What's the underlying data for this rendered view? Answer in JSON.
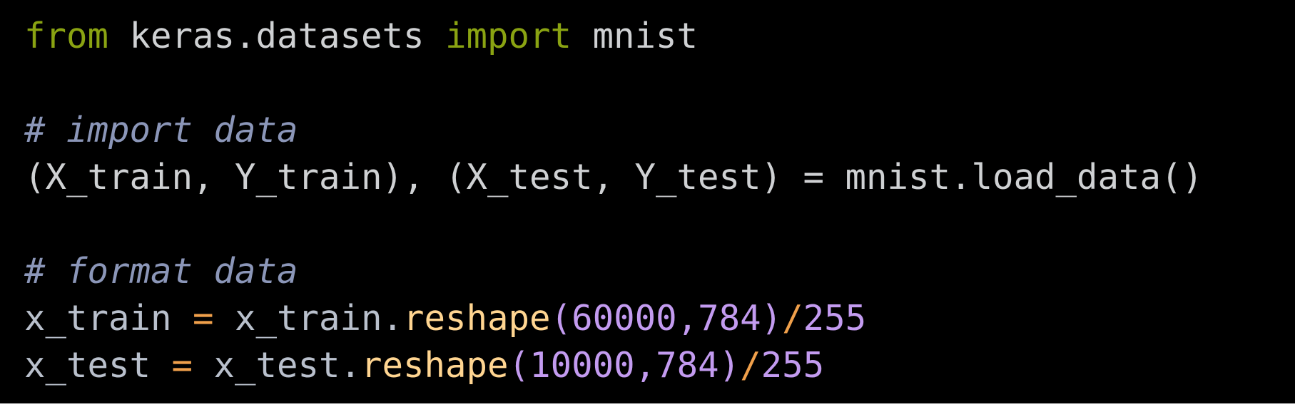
{
  "code": {
    "line1": {
      "kw_from": "from",
      "module": " keras.datasets ",
      "kw_import": "import",
      "name": " mnist"
    },
    "line3": {
      "comment": "# import data"
    },
    "line4": {
      "text": "(X_train, Y_train), (X_test, Y_test) = mnist.load_data()"
    },
    "line6": {
      "comment": "# format data"
    },
    "line7": {
      "var": "x_train ",
      "eq": "=",
      "obj": " x_train.",
      "method": "reshape",
      "args": "(60000,784)",
      "div": "/",
      "divisor": "255"
    },
    "line8": {
      "var": "x_test ",
      "eq": "=",
      "obj": " x_test.",
      "method": "reshape",
      "args": "(10000,784)",
      "div": "/",
      "divisor": "255"
    }
  },
  "colors": {
    "background": "#000000",
    "keyword": "#8aa312",
    "comment": "#8b96b8",
    "operator": "#f0a04b",
    "function": "#ffd591",
    "number": "#c39bf0",
    "plain": "#cfd1d3"
  }
}
